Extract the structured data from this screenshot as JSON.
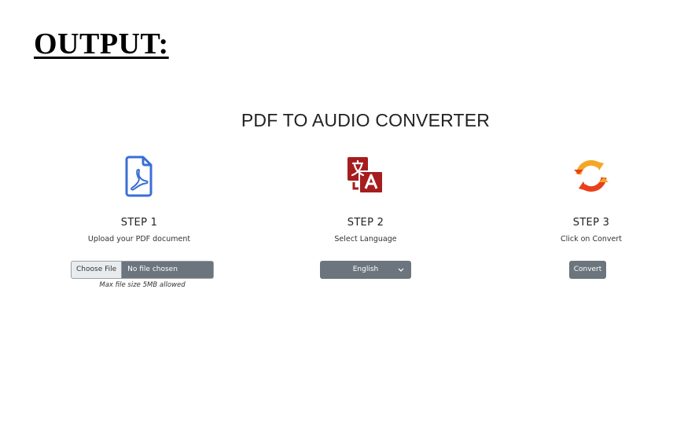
{
  "document": {
    "heading": "OUTPUT:"
  },
  "app": {
    "title": "PDF TO AUDIO CONVERTER"
  },
  "steps": [
    {
      "title": "STEP 1",
      "description": "Upload your PDF document",
      "icon": "pdf-file-icon",
      "icon_color": "#3b6fd4"
    },
    {
      "title": "STEP 2",
      "description": "Select Language",
      "icon": "translate-icon",
      "icon_color": "#a61d1d"
    },
    {
      "title": "STEP 3",
      "description": "Click on Convert",
      "icon": "convert-arrows-icon",
      "icon_colors": [
        "#f5a623",
        "#e8401c"
      ]
    }
  ],
  "upload": {
    "button_label": "Choose File",
    "status": "No file chosen",
    "note": "Max file size 5MB allowed"
  },
  "language_select": {
    "value": "English"
  },
  "convert": {
    "label": "Convert"
  },
  "colors": {
    "control_bg": "#6c757d",
    "file_button_bg": "#e9ecef"
  }
}
